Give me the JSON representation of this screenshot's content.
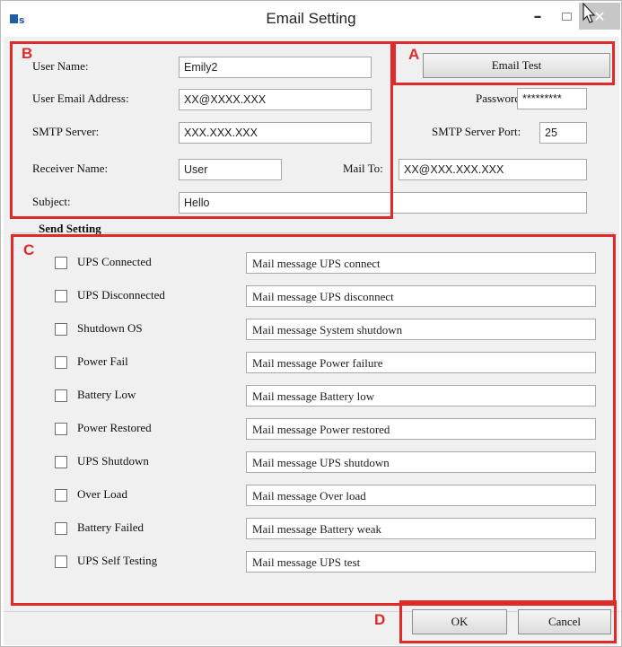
{
  "window": {
    "title": "Email Setting",
    "minimize_glyph": "–",
    "close_glyph": "✕",
    "app_icon": "ups-app-icon"
  },
  "fields": {
    "user_name": {
      "label": "User Name:",
      "value": "Emily2"
    },
    "user_email": {
      "label": "User Email Address:",
      "value": "XX@XXXX.XXX"
    },
    "smtp_server": {
      "label": "SMTP Server:",
      "value": "XXX.XXX.XXX"
    },
    "password": {
      "label": "Password:",
      "value": "*********"
    },
    "smtp_port": {
      "label": "SMTP Server Port:",
      "value": "25"
    },
    "receiver_name": {
      "label": "Receiver Name:",
      "value": "User"
    },
    "mail_to": {
      "label": "Mail To:",
      "value": "XX@XXX.XXX.XXX"
    },
    "subject": {
      "label": "Subject:",
      "value": "Hello"
    }
  },
  "email_test_label": "Email Test",
  "send_setting": {
    "title": "Send Setting",
    "events": [
      {
        "label": "UPS Connected",
        "message": "Mail message UPS connect",
        "checked": false
      },
      {
        "label": "UPS Disconnected",
        "message": "Mail message UPS disconnect",
        "checked": false
      },
      {
        "label": "Shutdown OS",
        "message": "Mail message System shutdown",
        "checked": false
      },
      {
        "label": "Power Fail",
        "message": "Mail message Power failure",
        "checked": false
      },
      {
        "label": "Battery Low",
        "message": "Mail message Battery low",
        "checked": false
      },
      {
        "label": "Power Restored",
        "message": "Mail message Power restored",
        "checked": false
      },
      {
        "label": "UPS Shutdown",
        "message": "Mail message UPS shutdown",
        "checked": false
      },
      {
        "label": "Over Load",
        "message": "Mail message Over load",
        "checked": false
      },
      {
        "label": "Battery Failed",
        "message": "Mail message Battery weak",
        "checked": false
      },
      {
        "label": "UPS Self Testing",
        "message": "Mail message UPS test",
        "checked": false
      }
    ]
  },
  "buttons": {
    "ok": "OK",
    "cancel": "Cancel"
  },
  "annotations": {
    "a": "A",
    "b": "B",
    "c": "C",
    "d": "D",
    "color": "#e02a2a"
  }
}
